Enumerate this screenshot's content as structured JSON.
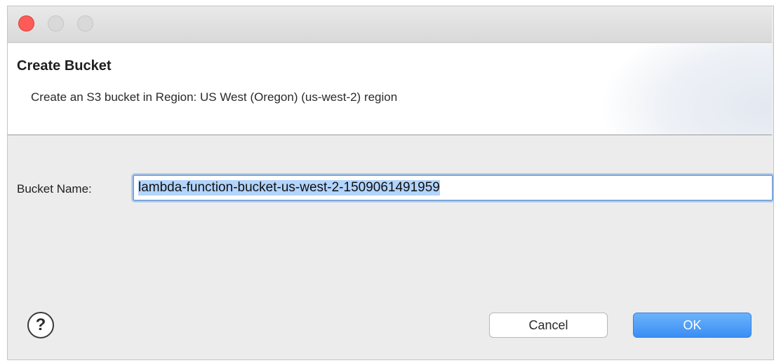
{
  "window": {
    "controls": [
      "close-icon",
      "minimize-icon",
      "maximize-icon"
    ],
    "accent_close": "#fc5b57",
    "accent_ok": "#3a8ef4"
  },
  "header": {
    "title": "Create Bucket",
    "subtitle": "Create an S3 bucket in Region: US West (Oregon) (us-west-2) region"
  },
  "form": {
    "bucket_name_label": "Bucket Name:",
    "bucket_name_value": "lambda-function-bucket-us-west-2-1509061491959"
  },
  "footer": {
    "help_glyph": "?",
    "help_icon": "question-mark-icon",
    "cancel_label": "Cancel",
    "ok_label": "OK"
  }
}
